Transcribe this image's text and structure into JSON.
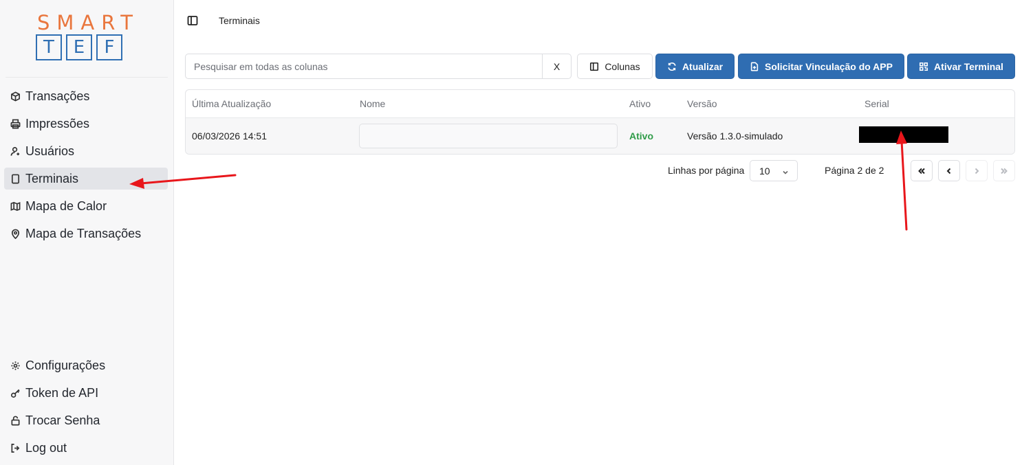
{
  "brand": {
    "logo_top": "SMART",
    "logo_letters": [
      "T",
      "E",
      "F"
    ]
  },
  "sidebar": {
    "items": [
      {
        "label": "Transações",
        "icon": "box-icon"
      },
      {
        "label": "Impressões",
        "icon": "printer-icon"
      },
      {
        "label": "Usuários",
        "icon": "user-icon"
      },
      {
        "label": "Terminais",
        "icon": "tablet-icon",
        "active": true
      },
      {
        "label": "Mapa de Calor",
        "icon": "map-icon"
      },
      {
        "label": "Mapa de Transações",
        "icon": "map-pin-icon"
      }
    ],
    "bottom_items": [
      {
        "label": "Configurações",
        "icon": "gear-icon"
      },
      {
        "label": "Token de API",
        "icon": "key-icon"
      },
      {
        "label": "Trocar Senha",
        "icon": "lock-icon"
      },
      {
        "label": "Log out",
        "icon": "logout-icon"
      }
    ]
  },
  "header": {
    "breadcrumb": "Terminais"
  },
  "toolbar": {
    "search_placeholder": "Pesquisar em todas as colunas",
    "clear_label": "X",
    "columns_label": "Colunas",
    "refresh_label": "Atualizar",
    "request_app_label": "Solicitar Vinculação do APP",
    "activate_label": "Ativar Terminal"
  },
  "table": {
    "columns": [
      "Última Atualização",
      "Nome",
      "Ativo",
      "Versão",
      "Serial"
    ],
    "rows": [
      {
        "updated": "06/03/2026 14:51",
        "name": "",
        "active": "Ativo",
        "version": "Versão 1.3.0-simulado",
        "serial": ""
      }
    ]
  },
  "pagination": {
    "rows_per_page_label": "Linhas por página",
    "rows_per_page_value": "10",
    "page_info": "Página 2 de 2",
    "first": "«",
    "prev": "‹",
    "next": "›",
    "last": "»"
  },
  "colors": {
    "primary": "#2f6db2",
    "logo_orange": "#e9763d",
    "logo_blue": "#2f6fb3",
    "active_green": "#2e9b47",
    "annotation_red": "#e8161b"
  }
}
